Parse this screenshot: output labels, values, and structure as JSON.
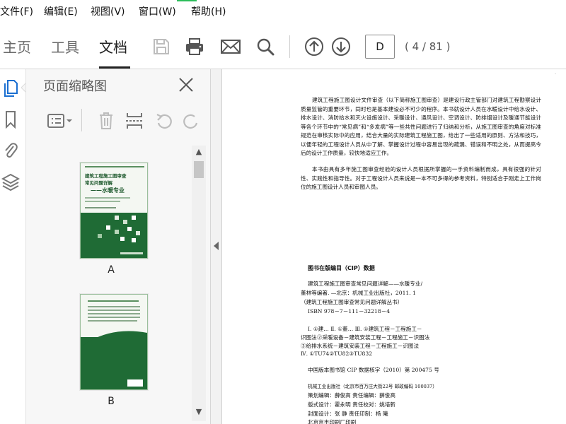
{
  "menu": [
    "文件(F)",
    "编辑(E)",
    "视图(V)",
    "窗口(W)",
    "帮助(H)"
  ],
  "toolbar": {
    "tabs": [
      "主页",
      "工具",
      "文档"
    ],
    "active_tab": "文档",
    "page_input": "D",
    "page_count": "( 4 / 81 )"
  },
  "panel": {
    "title": "页面缩略图",
    "thumbnails": [
      {
        "label": "A",
        "cover_title_1": "建筑工程施工图审查",
        "cover_title_2": "常见问题详解",
        "cover_subtitle": "——水暖专业"
      },
      {
        "label": "B"
      }
    ]
  },
  "document": {
    "paragraphs": [
      "建筑工程施工图设计文件审查（以下简称施工图审查）是建设行政主管部门对建筑工程勘察设计质量监管的重要环节，同时也是基本建设必不可少的程序。本书就设计人员在水暖设计中给水设计、排水设计、消防给水和灭火设施设计、采暖设计、通风设计、空调设计、防排烟设计及暖通节能设计等各个环节中的“常见病”和“多发病”等一些共性问题进行了归纳和分析，从施工图审查的角度对标准规范在审核实际中的应用，结合大量的实际建筑工程施工图，给出了一些适用的原则、方法和技巧，以便年轻的工程设计人员从中了解、掌握设计过程中容易出现的疏漏、错误和不明之处，从而提高今后的设计工作质量，较快地适应工作。",
      "本书由具有多年施工图审查经验的设计人员根据所掌握的一手资料编制而成，具有很强的针对性、实践性和指导性。对于工程设计人员来说是一本不可多得的参考资料，特别适合于刚走上工作岗位的施工图设计人员和审图人员。"
    ],
    "cip_title": "图书在版编目（CIP）数据",
    "cip_lines": [
      "建筑工程施工图审查常见问题详解——水暖专业/",
      "董林等编著. —北京：机械工业出版社，2011. 1",
      "（建筑工程施工图审查常见问题详解丛书）",
      "ISBN 978－7－111－32218－4",
      "Ⅰ. ①建…  Ⅱ. ①董…  Ⅲ. ①建筑工程－工程施工－",
      "识图法②采暖设备－建筑安装工程－工程施工－识图法",
      "③给排水系统－建筑安装工程－工程施工－识图法",
      "Ⅳ. ①TU74②TU82③TU832",
      "中国版本图书馆 CIP 数据核字（2010）第 200475 号",
      "机械工业出版社（北京市百万庄大街22号  邮政编码 100037）",
      "策划编辑：薛俊高   责任编辑：薛俊高",
      "版式设计：霍永明   责任校对：姚培新",
      "封面设计：张  静   责任印制：杨  曦",
      "北京京丰印刷厂印刷"
    ]
  },
  "colors": {
    "cover_green": "#1f6b35",
    "accent_green": "#2bbd5a",
    "icon_blue": "#1b6fd1"
  }
}
